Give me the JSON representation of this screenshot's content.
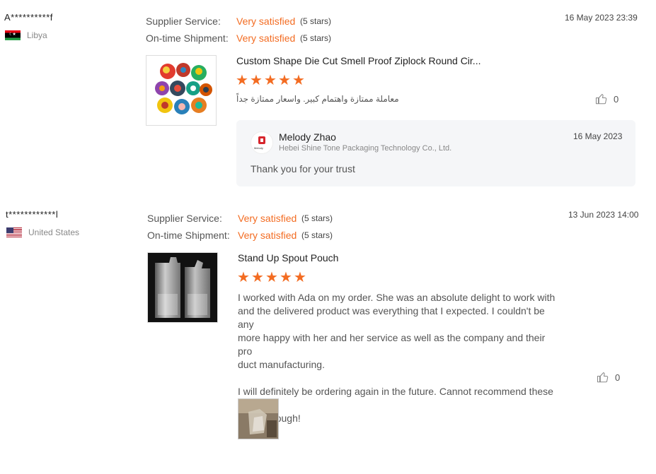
{
  "reviews": [
    {
      "user": "A**********f",
      "country": "Libya",
      "ratings": [
        {
          "label": "Supplier Service:",
          "value": "Very satisfied",
          "stars": "(5 stars)"
        },
        {
          "label": "On-time Shipment:",
          "value": "Very satisfied",
          "stars": "(5 stars)"
        }
      ],
      "date": "16 May 2023 23:39",
      "product_title": "Custom Shape Die Cut Smell Proof Ziplock Round Cir...",
      "star_rating": 5,
      "text": "معاملة ممتازة واهتمام كبير. واسعار ممتازة جداً",
      "likes": "0",
      "reply": {
        "name": "Melody Zhao",
        "company": "Hebei Shine Tone Packaging Technology Co., Ltd.",
        "date": "16 May 2023",
        "text": "Thank you for your trust",
        "logo_text": "Melody"
      }
    },
    {
      "user": "t************l",
      "country": "United States",
      "ratings": [
        {
          "label": "Supplier Service:",
          "value": "Very satisfied",
          "stars": "(5 stars)"
        },
        {
          "label": "On-time Shipment:",
          "value": "Very satisfied",
          "stars": "(5 stars)"
        }
      ],
      "date": "13 Jun 2023 14:00",
      "product_title": "Stand Up Spout Pouch",
      "star_rating": 5,
      "text": "I worked with Ada on my order. She was an absolute delight to work with\nand the delivered product was everything that I expected. I couldn't be any\nmore happy with her and her service as well as the company and their pro\nduct manufacturing.\n\nI will definitely be ordering again in the future. Cannot recommend these p\neople enough!",
      "likes": "0"
    }
  ],
  "colors": {
    "accent": "#f36c22",
    "reply_bg": "#f5f6f8"
  },
  "icons": {
    "like": "thumbs-up-icon",
    "star": "star-icon"
  }
}
